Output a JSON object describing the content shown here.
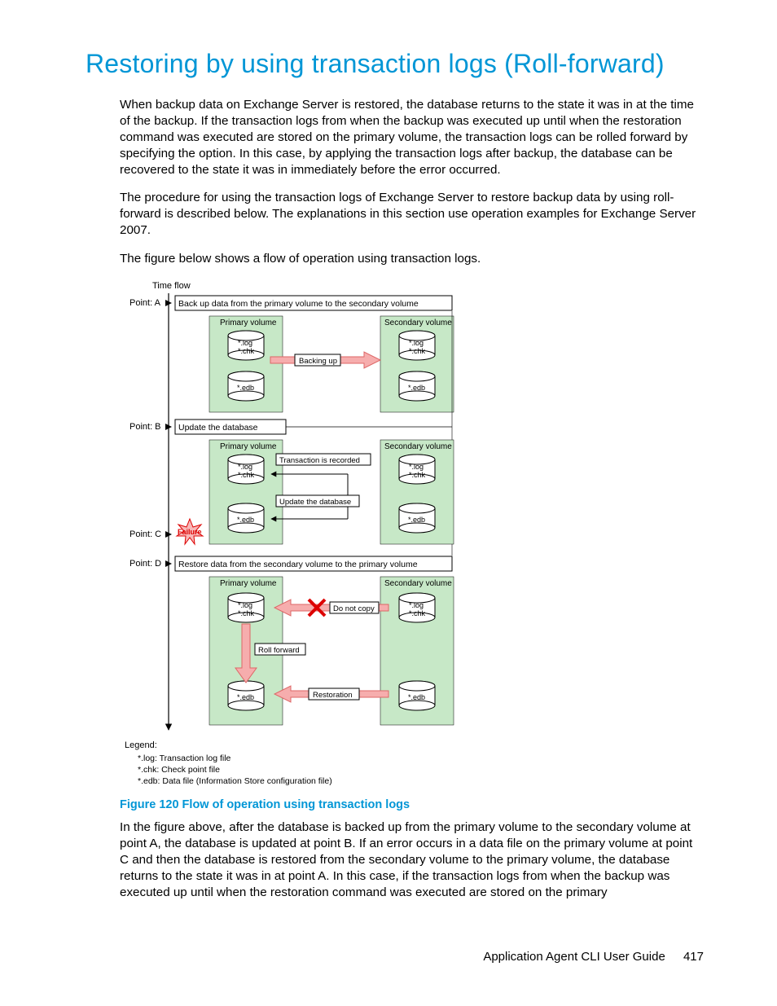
{
  "heading": "Restoring by using transaction logs (Roll-forward)",
  "para1_a": "When backup data on Exchange Server is restored, the database returns to the state it was in at the time of the backup. If the transaction logs from when the backup was executed up until when the restoration command was executed are stored on the primary volume, the transaction logs can be rolled forward by specifying the ",
  "para1_b": " option. In this case, by applying the transaction logs after backup, the database can be recovered to the state it was in immediately before the error occurred.",
  "para2": "The procedure for using the transaction logs of Exchange Server to restore backup data by using roll-forward is described below. The explanations in this section use operation examples for Exchange Server 2007.",
  "para3": "The figure below shows a flow of operation using transaction logs.",
  "fig": {
    "time_flow": "Time flow",
    "pointA": "Point: A",
    "pointB": "Point: B",
    "pointC": "Point: C",
    "pointD": "Point: D",
    "stepA": "Back up data from the primary volume to the secondary volume",
    "stepB": "Update the database",
    "stepD": "Restore data from the secondary volume to the primary volume",
    "primary": "Primary volume",
    "secondary": "Secondary volume",
    "logchk": "*.log\n*.chk",
    "edb": "*.edb",
    "backing_up": "Backing up",
    "tx_recorded": "Transaction is recorded",
    "update_db": "Update the database",
    "failure": "Failure",
    "do_not_copy": "Do not copy",
    "roll_forward": "Roll forward",
    "restoration": "Restoration",
    "legend_h": "Legend:",
    "legend1": "*.log: Transaction log file",
    "legend2": "*.chk: Check point file",
    "legend3": "*.edb: Data file (Information Store configuration file)"
  },
  "figure_caption": "Figure 120 Flow of operation using transaction logs",
  "para4": "In the figure above, after the database is backed up from the primary volume to the secondary volume at point A, the database is updated at point B. If an error occurs in a data file on the primary volume at point C and then the database is restored from the secondary volume to the primary volume, the database returns to the state it was in at point A. In this case, if the transaction logs from when the backup was executed up until when the restoration command was executed are stored on the primary",
  "footer_text": "Application Agent CLI User Guide",
  "footer_page": "417"
}
